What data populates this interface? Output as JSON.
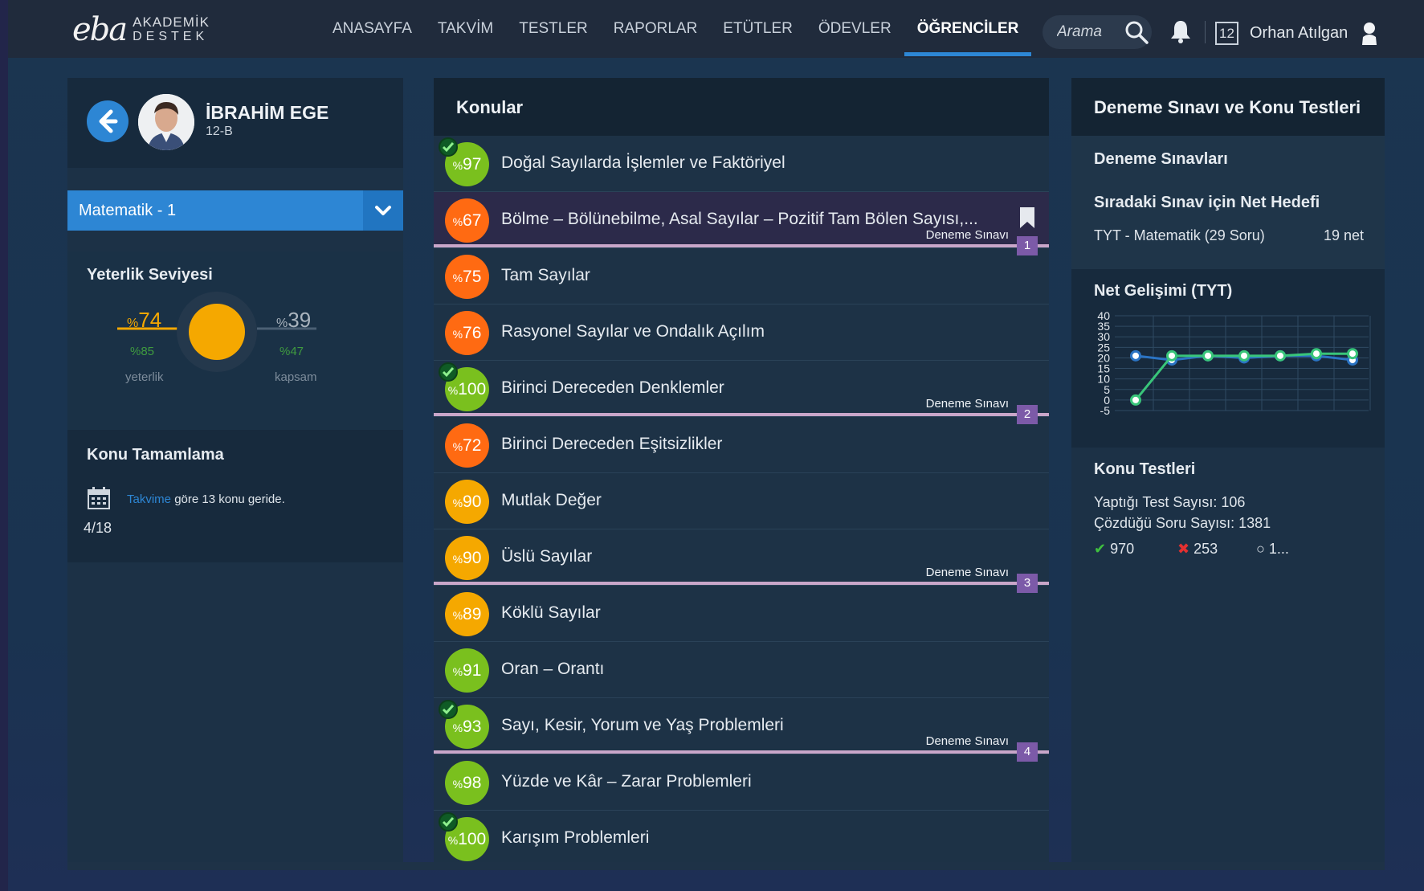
{
  "brand": {
    "mark": "eba",
    "line1": "AKADEMİK",
    "line2": "DESTEK"
  },
  "nav": {
    "items": [
      {
        "label": "ANASAYFA",
        "active": false
      },
      {
        "label": "TAKVİM",
        "active": false
      },
      {
        "label": "TESTLER",
        "active": false
      },
      {
        "label": "RAPORLAR",
        "active": false
      },
      {
        "label": "ETÜTLER",
        "active": false
      },
      {
        "label": "ÖDEVLER",
        "active": false
      },
      {
        "label": "ÖĞRENCİLER",
        "active": true
      }
    ]
  },
  "header": {
    "search_placeholder": "Arama",
    "calendar_day": "12",
    "user_name": "Orhan Atılgan"
  },
  "student": {
    "name": "İBRAHİM EGE",
    "class": "12-B"
  },
  "subject": {
    "selected": "Matematik - 1"
  },
  "level": {
    "title": "Yeterlik Seviyesi",
    "yeterlik_value": "74",
    "yeterlik_sub": "85",
    "yeterlik_label": "yeterlik",
    "kapsam_value": "39",
    "kapsam_sub": "47",
    "kapsam_label": "kapsam",
    "percent_sign": "%"
  },
  "completion": {
    "title": "Konu Tamamlama",
    "link": "Takvime",
    "text": "göre 13 konu geride.",
    "progress": "4/18"
  },
  "topics": {
    "title": "Konular",
    "exam_label": "Deneme Sınavı",
    "items": [
      {
        "score": "97",
        "name": "Doğal Sayılarda İşlemler ve Faktöriyel",
        "color": "#7ac01e",
        "check": true
      },
      {
        "score": "67",
        "name": "Bölme – Bölünebilme, Asal Sayılar – Pozitif Tam Bölen Sayısı,...",
        "color": "#ff6a12",
        "highlight": true,
        "bookmark": true,
        "exam_after": "1"
      },
      {
        "score": "75",
        "name": "Tam Sayılar",
        "color": "#ff6a12"
      },
      {
        "score": "76",
        "name": "Rasyonel Sayılar ve Ondalık Açılım",
        "color": "#ff6a12"
      },
      {
        "score": "100",
        "name": "Birinci Dereceden Denklemler",
        "color": "#7ac01e",
        "check": true,
        "exam_after": "2"
      },
      {
        "score": "72",
        "name": "Birinci Dereceden Eşitsizlikler",
        "color": "#ff6a12"
      },
      {
        "score": "90",
        "name": "Mutlak Değer",
        "color": "#f5a800"
      },
      {
        "score": "90",
        "name": "Üslü Sayılar",
        "color": "#f5a800",
        "exam_after": "3"
      },
      {
        "score": "89",
        "name": "Köklü Sayılar",
        "color": "#f5a800"
      },
      {
        "score": "91",
        "name": "Oran – Orantı",
        "color": "#7ac01e"
      },
      {
        "score": "93",
        "name": "Sayı, Kesir, Yorum ve Yaş Problemleri",
        "color": "#7ac01e",
        "check": true,
        "exam_after": "4"
      },
      {
        "score": "98",
        "name": "Yüzde ve Kâr – Zarar Problemleri",
        "color": "#7ac01e"
      },
      {
        "score": "100",
        "name": "Karışım Problemleri",
        "color": "#7ac01e",
        "check": true
      }
    ]
  },
  "right": {
    "title": "Deneme Sınavı ve Konu Testleri",
    "exams_title": "Deneme Sınavları",
    "target_title": "Sıradaki Sınav için Net Hedefi",
    "target_exam": "TYT - Matematik (29 Soru)",
    "target_value": "19 net",
    "chart_title": "Net Gelişimi (TYT)",
    "tests_title": "Konu Testleri",
    "test_count": "Yaptığı Test Sayısı: 106",
    "question_count": "Çözdüğü Soru Sayısı: 1381",
    "correct": "970",
    "wrong": "253",
    "empty": "1..."
  },
  "chart_data": {
    "type": "line",
    "title": "Net Gelişimi (TYT)",
    "x": [
      1,
      2,
      3,
      4,
      5,
      6,
      7
    ],
    "ylim": [
      -5,
      40
    ],
    "yticks": [
      "40",
      "35",
      "30",
      "25",
      "20",
      "15",
      "10",
      "5",
      "0",
      "-5"
    ],
    "grid": true,
    "series": [
      {
        "color": "#2b74c4",
        "values": [
          21,
          19,
          21,
          20,
          21,
          21,
          19
        ]
      },
      {
        "color": "#39c57a",
        "values": [
          0,
          21,
          21,
          21,
          21,
          22,
          22
        ]
      }
    ]
  },
  "colors": {
    "accent": "#2d86d4",
    "orange": "#ff6a12",
    "amber": "#f5a800",
    "green": "#7ac01e",
    "exam_purple": "#7c5aa8"
  }
}
